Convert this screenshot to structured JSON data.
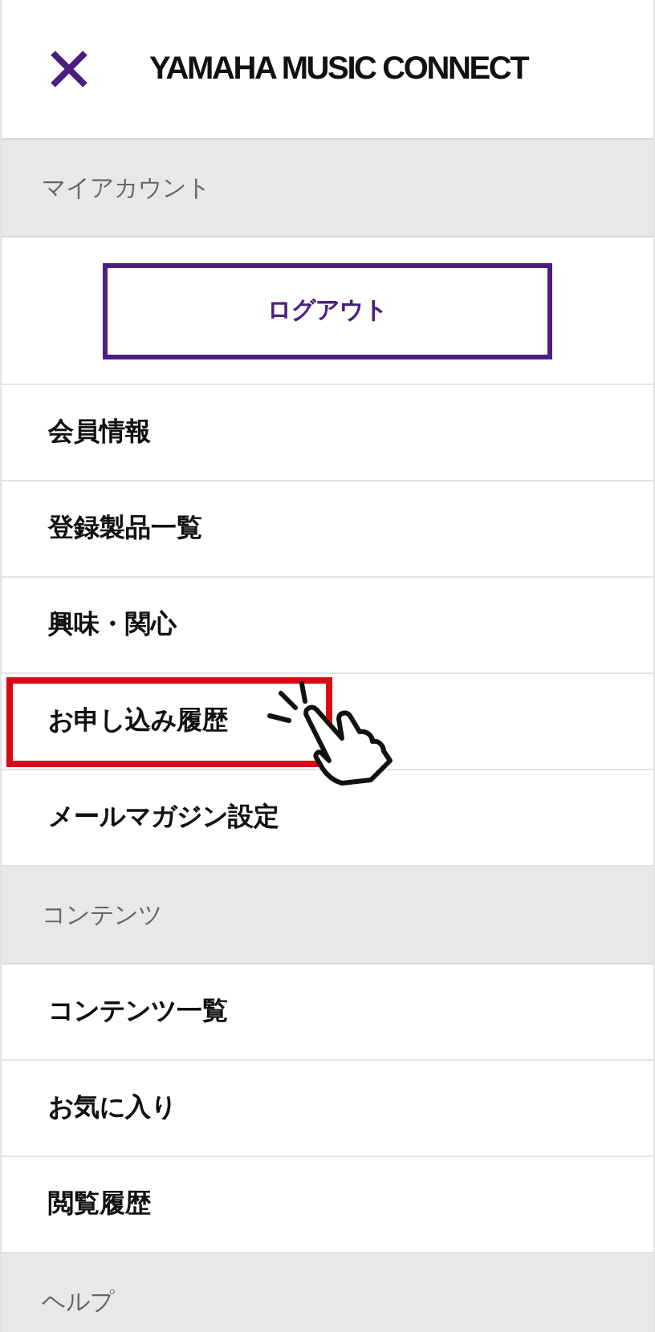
{
  "header": {
    "logo": "YAMAHA MUSIC CONNECT"
  },
  "menu": [
    {
      "kind": "section",
      "label": "マイアカウント"
    },
    {
      "kind": "button",
      "label": "ログアウト"
    },
    {
      "kind": "item",
      "label": "会員情報",
      "highlighted": false
    },
    {
      "kind": "item",
      "label": "登録製品一覧",
      "highlighted": false
    },
    {
      "kind": "item",
      "label": "興味・関心",
      "highlighted": false
    },
    {
      "kind": "item",
      "label": "お申し込み履歴",
      "highlighted": true
    },
    {
      "kind": "item",
      "label": "メールマガジン設定",
      "highlighted": false
    },
    {
      "kind": "section",
      "label": "コンテンツ"
    },
    {
      "kind": "item",
      "label": "コンテンツ一覧",
      "highlighted": false
    },
    {
      "kind": "item",
      "label": "お気に入り",
      "highlighted": false
    },
    {
      "kind": "item",
      "label": "閲覧履歴",
      "highlighted": false
    },
    {
      "kind": "section",
      "label": "ヘルプ"
    }
  ]
}
